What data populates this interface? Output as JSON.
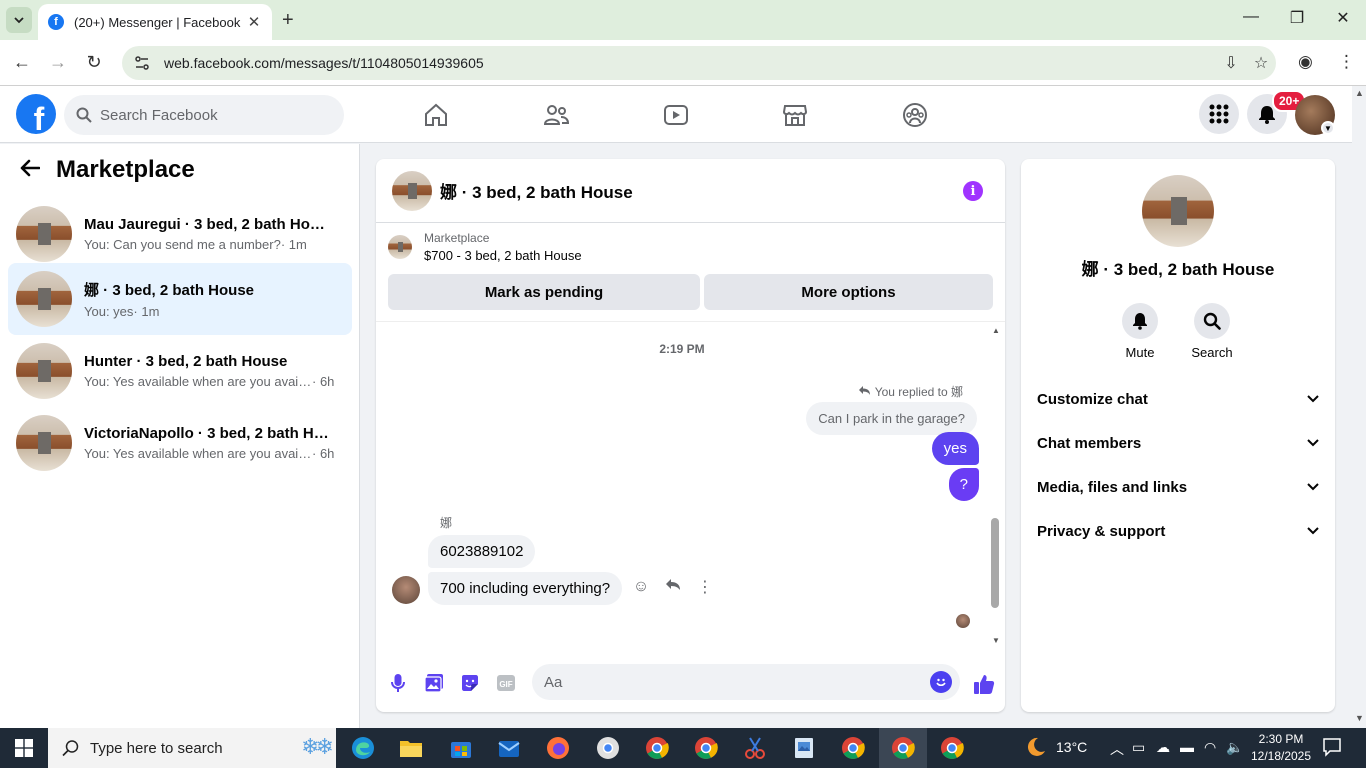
{
  "browser": {
    "tab_title": "(20+) Messenger | Facebook",
    "tab_favicon": "f",
    "url": "web.facebook.com/messages/t/1104805014939605"
  },
  "fb": {
    "search_placeholder": "Search Facebook",
    "logo_letter": "f",
    "notif_count": "20+",
    "brand_color": "#1877f2"
  },
  "sidebar": {
    "title": "Marketplace",
    "conversations": [
      {
        "name": "Mau Jauregui · 3 bed, 2 bath House",
        "preview": "You: Can you send me a number?",
        "time": " · 1m",
        "active": false
      },
      {
        "name": "娜 · 3 bed, 2 bath House",
        "preview": "You: yes",
        "time": " · 1m",
        "active": true
      },
      {
        "name": "Hunter · 3 bed, 2 bath House",
        "preview": "You: Yes available when are you available to see it?",
        "time": " · 6h",
        "active": false
      },
      {
        "name": "VictoriaNapollo · 3 bed, 2 bath House",
        "preview": "You: Yes available when are you available to see it?",
        "time": " · 6h",
        "active": false
      }
    ]
  },
  "chat": {
    "title": "娜 · 3 bed, 2 bath House",
    "marketplace_label": "Marketplace",
    "listing": "$700 - 3 bed, 2 bath House",
    "mark_pending": "Mark as pending",
    "more_options": "More options",
    "timestamp": "2:19 PM",
    "replied_to": "You replied to 娜",
    "quoted": "Can I park in the garage?",
    "out_msgs": [
      "yes",
      "?"
    ],
    "sender": "娜",
    "in_msgs": [
      "6023889102",
      "700 including everything?"
    ],
    "composer_placeholder": "Aa",
    "accent_color": "#5d43f0"
  },
  "details": {
    "name": "娜 · 3 bed, 2 bath House",
    "mute": "Mute",
    "search": "Search",
    "sections": [
      "Customize chat",
      "Chat members",
      "Media, files and links",
      "Privacy & support"
    ]
  },
  "taskbar": {
    "search_text": "Type here to search",
    "temp": "13°C",
    "time": "2:30 PM",
    "date": "12/18/2025"
  }
}
